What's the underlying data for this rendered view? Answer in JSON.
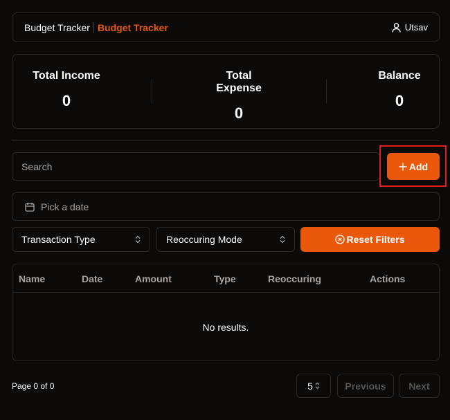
{
  "header": {
    "app_name": "Budget Tracker",
    "app_name_accent": "Budget Tracker",
    "username": "Utsav"
  },
  "summary": {
    "income_label": "Total Income",
    "income_value": "0",
    "expense_label": "Total Expense",
    "expense_value": "0",
    "balance_label": "Balance",
    "balance_value": "0"
  },
  "search": {
    "placeholder": "Search"
  },
  "add_button": {
    "label": "Add"
  },
  "date_picker": {
    "placeholder": "Pick a date"
  },
  "filters": {
    "type_label": "Transaction Type",
    "mode_label": "Reoccuring Mode",
    "reset_label": "Reset Filters"
  },
  "table": {
    "columns": [
      "Name",
      "Date",
      "Amount",
      "Type",
      "Reoccuring",
      "Actions"
    ],
    "empty_text": "No results."
  },
  "pagination": {
    "info": "Page 0 of 0",
    "page_size": "5",
    "previous_label": "Previous",
    "next_label": "Next"
  },
  "colors": {
    "accent": "#ea580c",
    "background": "#0c0a09",
    "border": "#292524",
    "highlight": "#e11d1d"
  }
}
